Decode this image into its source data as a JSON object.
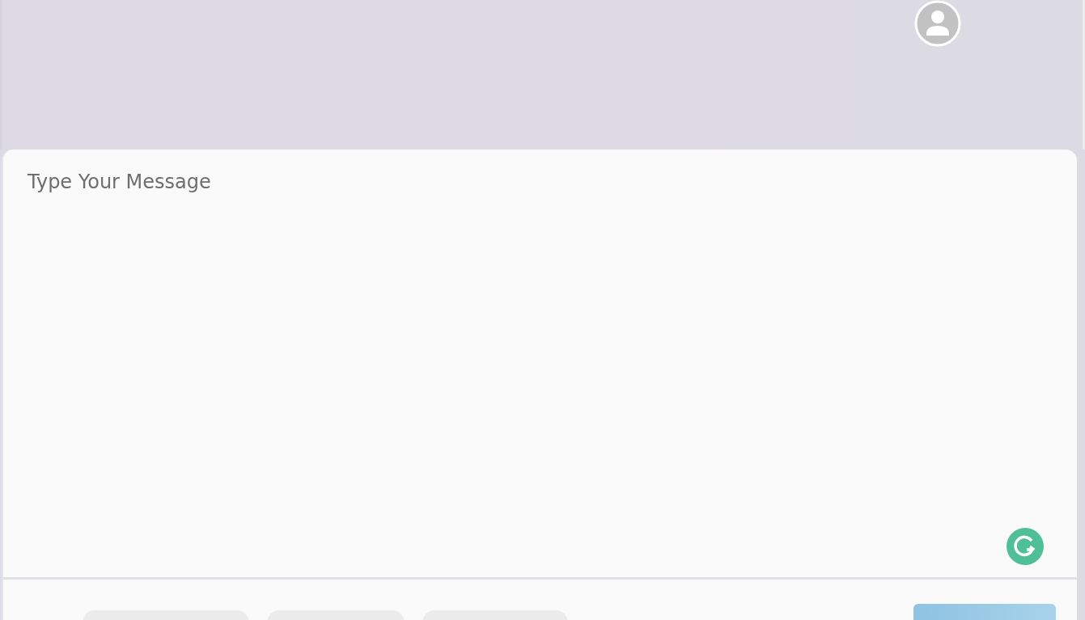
{
  "message_field": {
    "placeholder": "Type Your Message"
  }
}
